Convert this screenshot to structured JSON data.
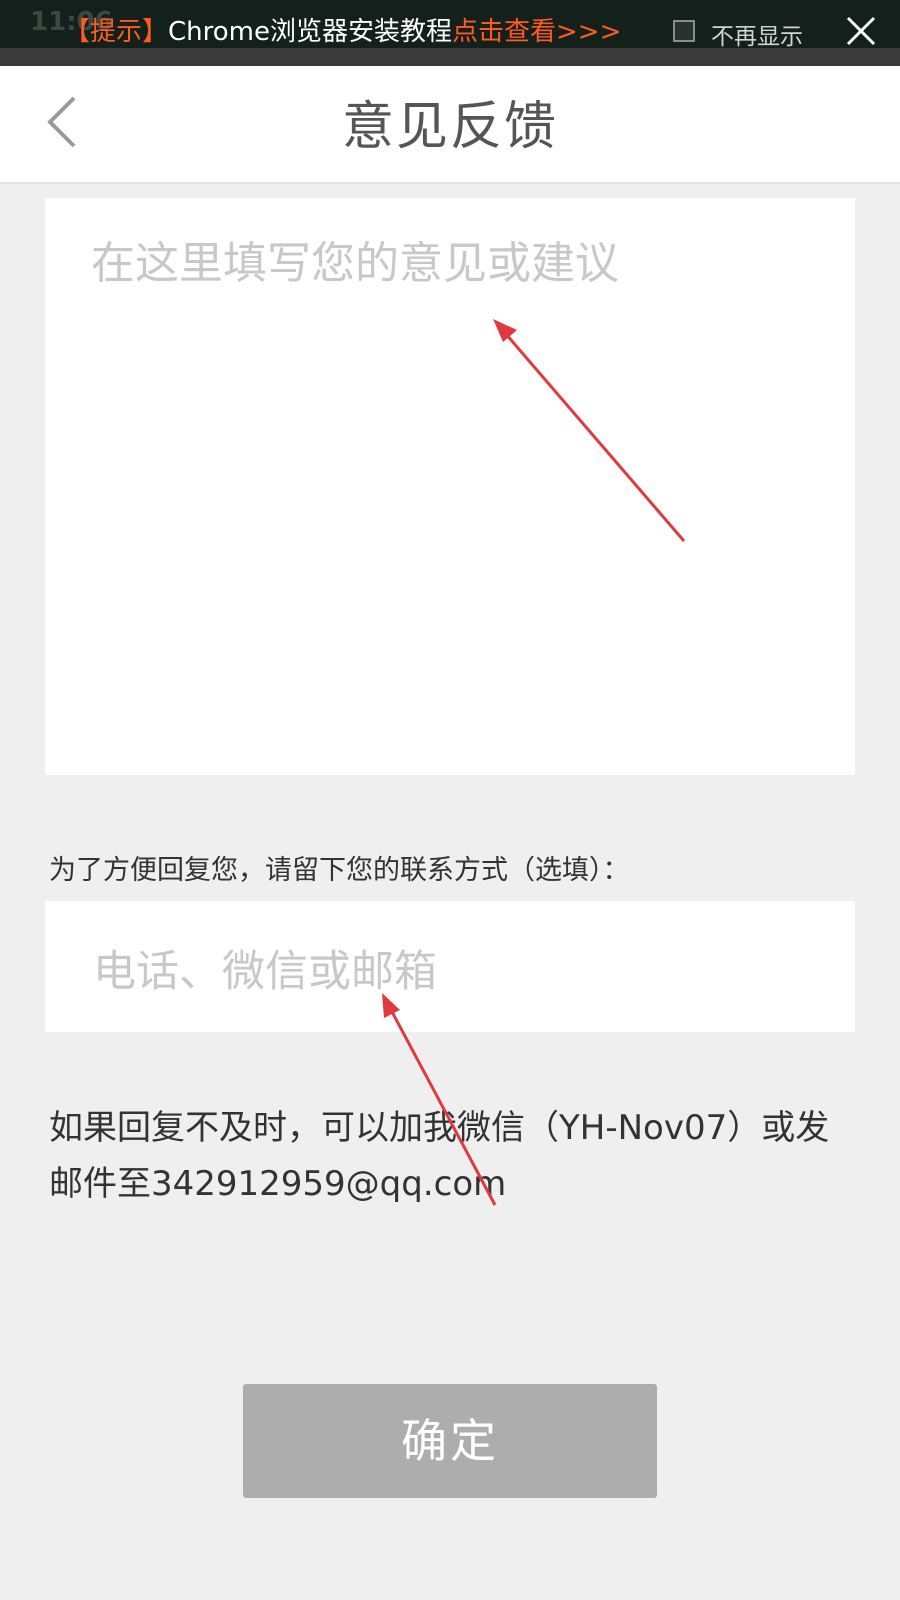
{
  "banner": {
    "status_time": "11:06",
    "tag": "【提示】",
    "title": "Chrome浏览器安装教程",
    "link": "点击查看>>>",
    "checkbox_label": "不再显示"
  },
  "header": {
    "title": "意见反馈"
  },
  "feedback": {
    "placeholder": "在这里填写您的意见或建议"
  },
  "contact": {
    "label": "为了方便回复您，请留下您的联系方式（选填）：",
    "placeholder": "电话、微信或邮箱"
  },
  "notice": {
    "text": "如果回复不及时，可以加我微信（YH-Nov07）或发邮件至342912959@qq.com"
  },
  "confirm": {
    "label": "确定"
  },
  "colors": {
    "accent": "#ff5a1f",
    "annotation_arrow": "#e0393e",
    "button_disabled": "#adadad"
  }
}
